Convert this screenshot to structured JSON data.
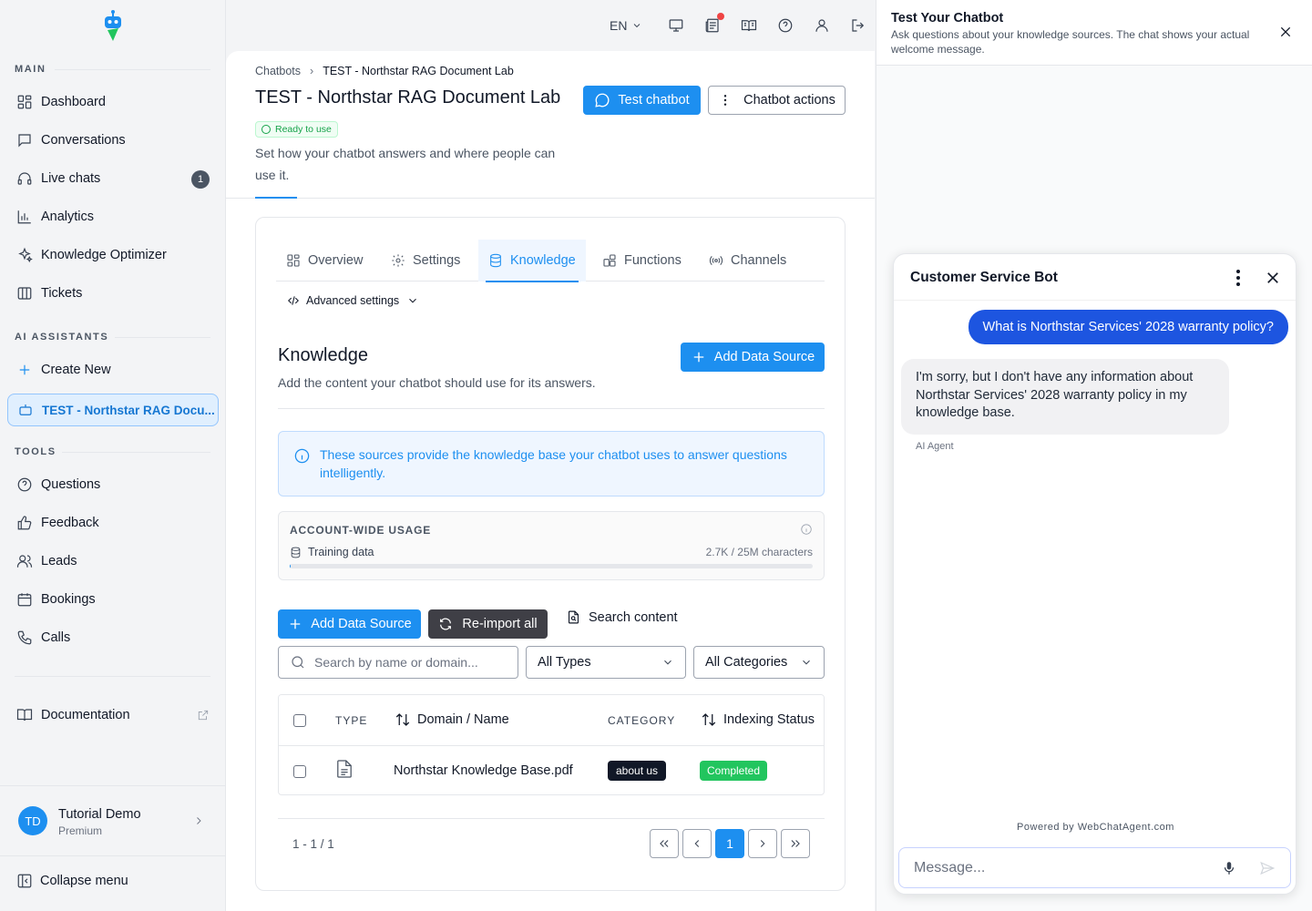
{
  "sidebar": {
    "sections": {
      "main": "MAIN",
      "ai": "AI ASSISTANTS",
      "tools": "TOOLS"
    },
    "main_items": [
      {
        "label": "Dashboard",
        "icon": "grid-icon"
      },
      {
        "label": "Conversations",
        "icon": "chat-icon"
      },
      {
        "label": "Live chats",
        "icon": "headset-icon",
        "badge": "1"
      },
      {
        "label": "Analytics",
        "icon": "bar-chart-icon"
      },
      {
        "label": "Knowledge Optimizer",
        "icon": "sparkles-icon"
      },
      {
        "label": "Tickets",
        "icon": "columns-icon"
      }
    ],
    "ai_items": [
      {
        "label": "Create New",
        "icon": "plus-icon"
      },
      {
        "label": "TEST - Northstar RAG Docu...",
        "icon": "bot-icon"
      }
    ],
    "tools_items": [
      {
        "label": "Questions",
        "icon": "question-icon"
      },
      {
        "label": "Feedback",
        "icon": "thumbs-up-icon"
      },
      {
        "label": "Leads",
        "icon": "users-icon"
      },
      {
        "label": "Bookings",
        "icon": "calendar-icon"
      },
      {
        "label": "Calls",
        "icon": "phone-icon"
      }
    ],
    "documentation": "Documentation",
    "user": {
      "initials": "TD",
      "name": "Tutorial Demo",
      "plan": "Premium"
    },
    "collapse": "Collapse menu"
  },
  "topbar": {
    "language": "EN"
  },
  "header": {
    "breadcrumb": [
      "Chatbots",
      "TEST - Northstar RAG Document Lab"
    ],
    "title": "TEST - Northstar RAG Document Lab",
    "status": "Ready to use",
    "description": "Set how your chatbot answers and where people can use it.",
    "test_button": "Test chatbot",
    "actions_button": "Chatbot actions"
  },
  "tabs": [
    "Overview",
    "Settings",
    "Knowledge",
    "Functions",
    "Channels"
  ],
  "active_tab": "Knowledge",
  "advanced_settings": "Advanced settings",
  "knowledge": {
    "title": "Knowledge",
    "subtitle": "Add the content your chatbot should use for its answers.",
    "add_button": "Add Data Source",
    "info": "These sources provide the knowledge base your chatbot uses to answer questions intelligently.",
    "usage": {
      "title": "ACCOUNT-WIDE USAGE",
      "label": "Training data",
      "value": "2.7K / 25M characters",
      "fraction": 0.000108
    },
    "actions": {
      "add": "Add Data Source",
      "reimport": "Re-import all",
      "search": "Search content"
    },
    "filters": {
      "search_placeholder": "Search by name or domain...",
      "type": "All Types",
      "category": "All Categories"
    },
    "table": {
      "headers": {
        "type": "TYPE",
        "name": "Domain / Name",
        "category": "CATEGORY",
        "status": "Indexing Status"
      },
      "rows": [
        {
          "type_icon": "document-icon",
          "name": "Northstar Knowledge Base.pdf",
          "category": "about us",
          "status": "Completed"
        }
      ]
    },
    "pagination": {
      "range": "1 - 1 / 1",
      "current": "1"
    }
  },
  "test_panel": {
    "title": "Test Your Chatbot",
    "subtitle": "Ask questions about your knowledge sources. The chat shows your actual welcome message.",
    "widget": {
      "title": "Customer Service Bot",
      "messages": [
        {
          "role": "user",
          "text": "What is Northstar Services' 2028 warranty policy?"
        },
        {
          "role": "bot",
          "text": "I'm sorry, but I don't have any information about Northstar Services' 2028 warranty policy in my knowledge base.",
          "author": "AI Agent"
        }
      ],
      "powered_by": "Powered by WebChatAgent.com",
      "input_placeholder": "Message..."
    }
  },
  "colors": {
    "accent": "#1d8ff0",
    "user_bubble": "#1d55e0",
    "success": "#22c55e",
    "dark_button": "#3f3f46"
  }
}
